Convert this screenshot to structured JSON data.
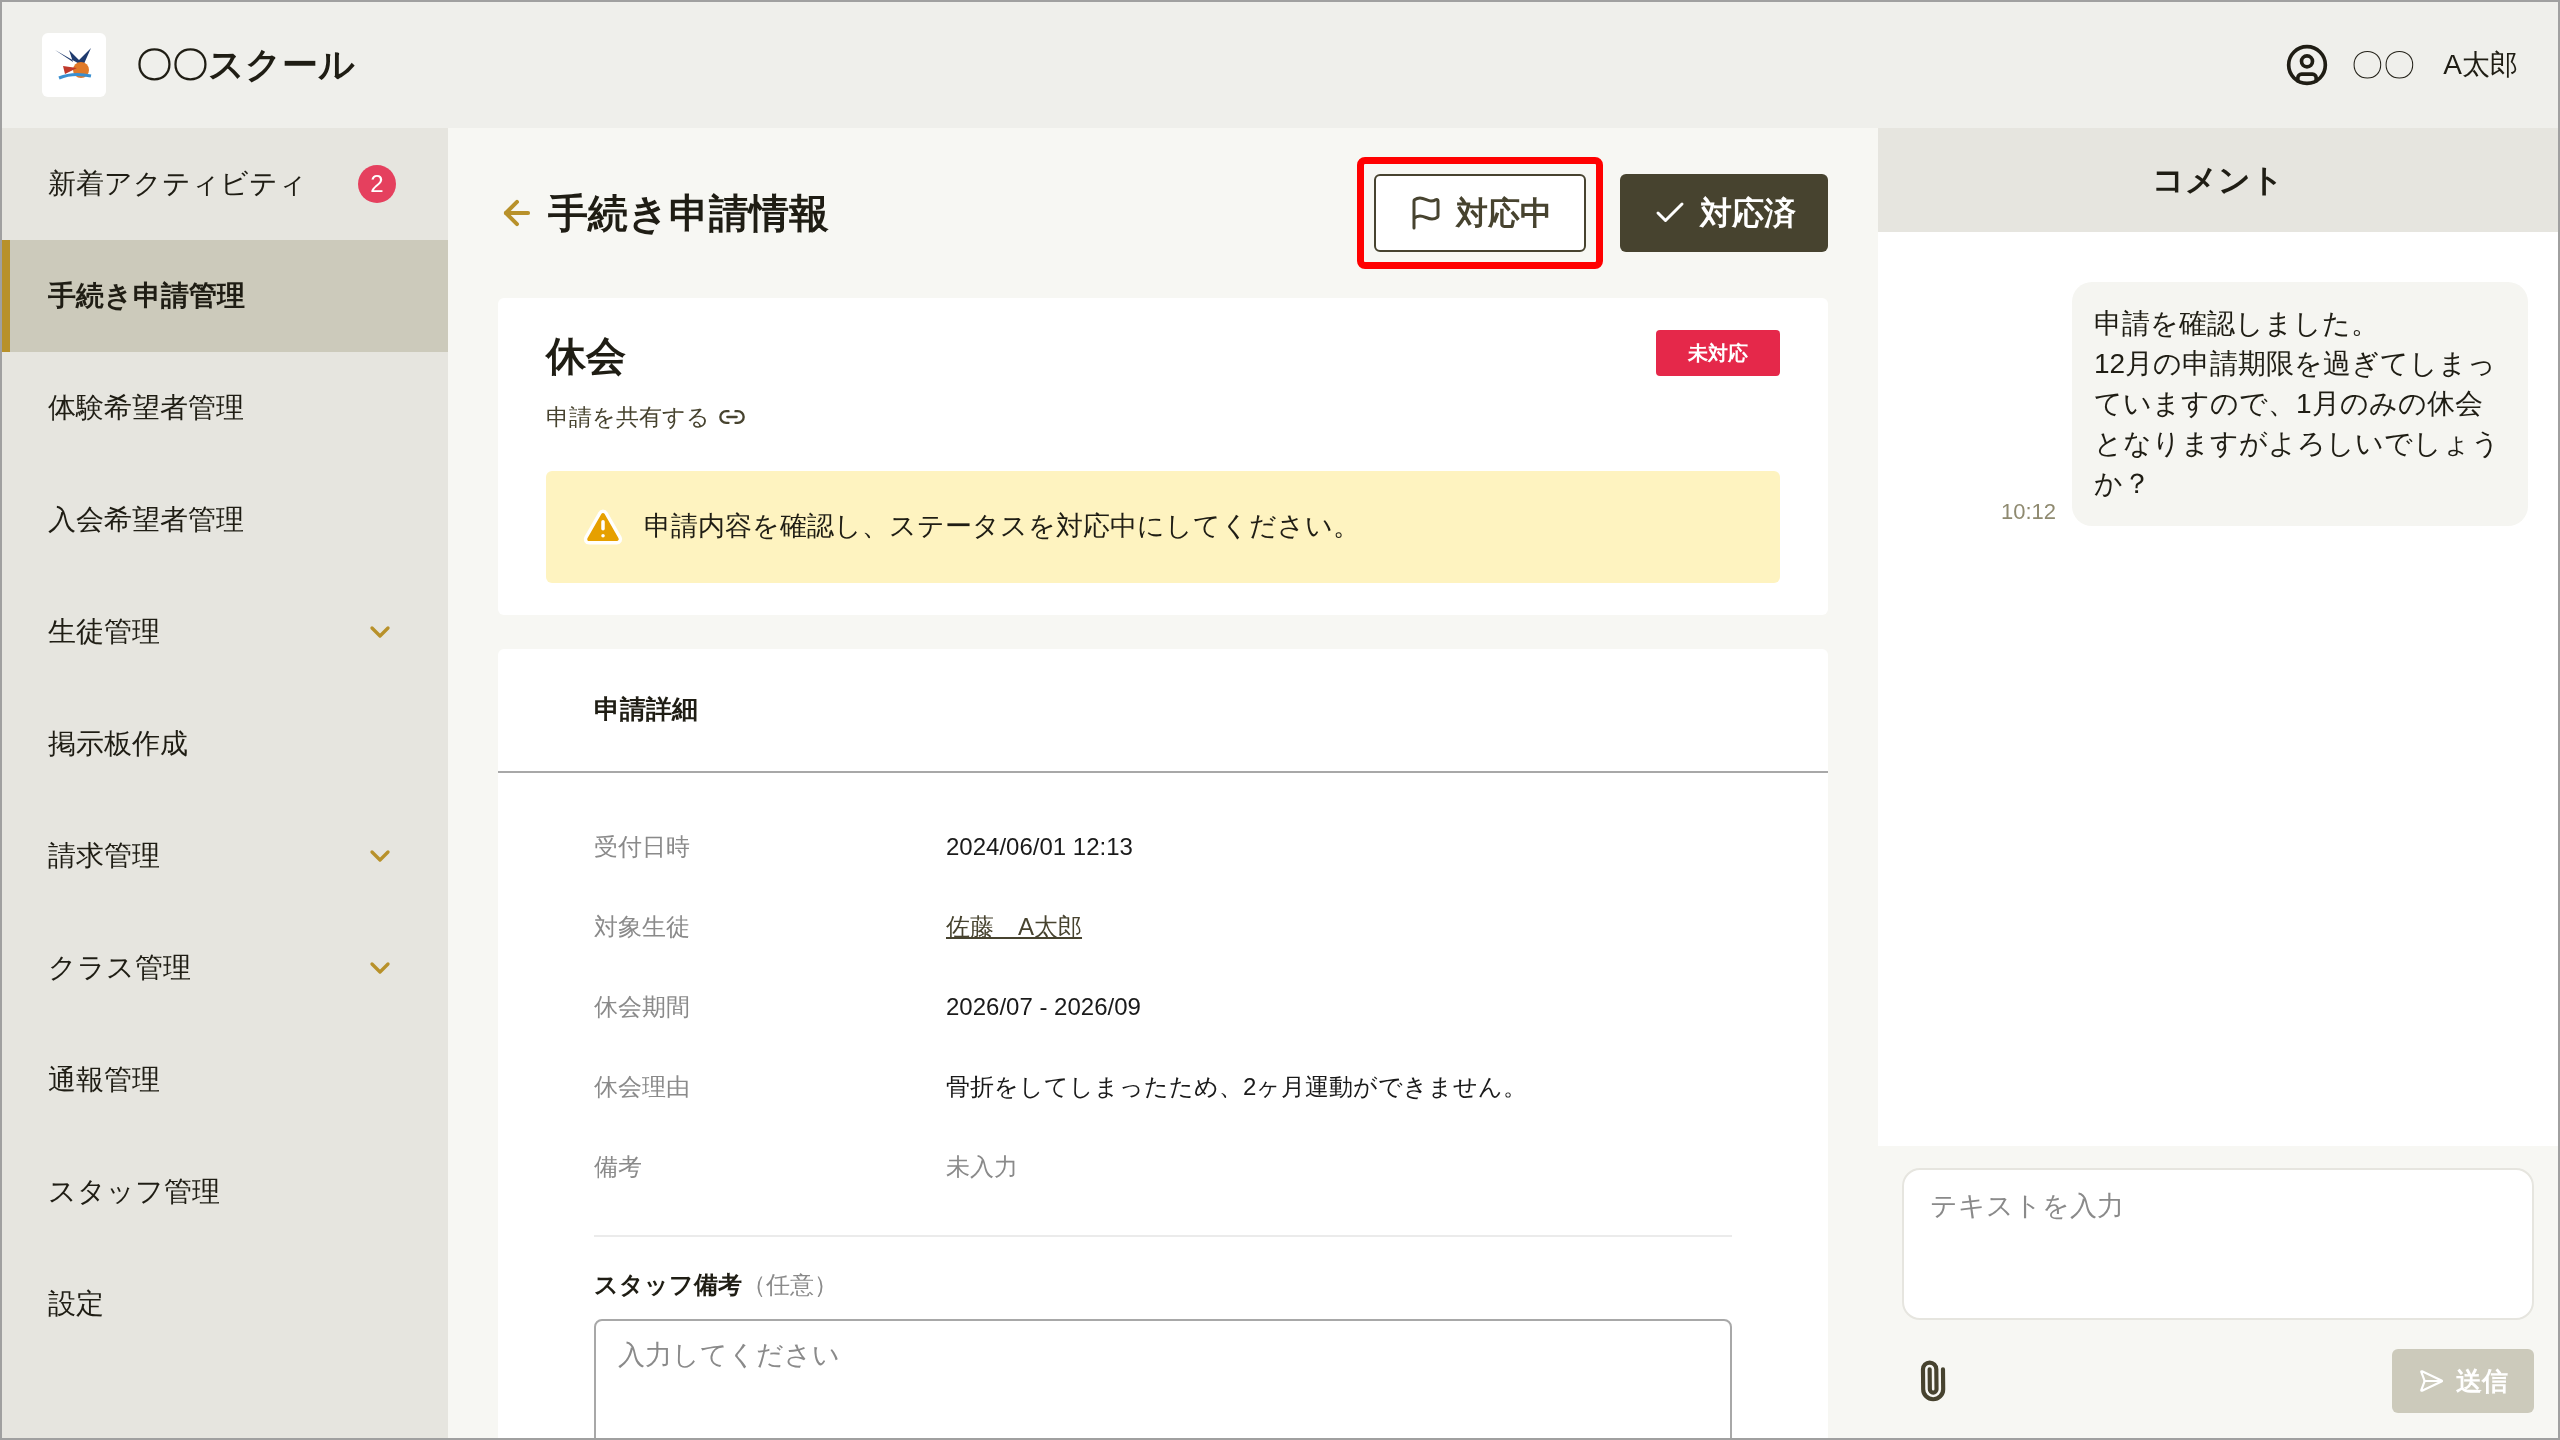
{
  "header": {
    "school_name": "〇〇スクール",
    "user_prefix": "〇〇",
    "user_name": "A太郎"
  },
  "sidebar": {
    "items": [
      {
        "label": "新着アクティビティ",
        "selected": false,
        "expandable": false,
        "badge": "2"
      },
      {
        "label": "手続き申請管理",
        "selected": true,
        "expandable": false
      },
      {
        "label": "体験希望者管理",
        "selected": false,
        "expandable": false
      },
      {
        "label": "入会希望者管理",
        "selected": false,
        "expandable": false
      },
      {
        "label": "生徒管理",
        "selected": false,
        "expandable": true
      },
      {
        "label": "掲示板作成",
        "selected": false,
        "expandable": false
      },
      {
        "label": "請求管理",
        "selected": false,
        "expandable": true
      },
      {
        "label": "クラス管理",
        "selected": false,
        "expandable": true
      },
      {
        "label": "通報管理",
        "selected": false,
        "expandable": false
      },
      {
        "label": "スタッフ管理",
        "selected": false,
        "expandable": false
      },
      {
        "label": "設定",
        "selected": false,
        "expandable": false
      }
    ]
  },
  "page": {
    "title": "手続き申請情報",
    "actions": [
      {
        "label": "対応中",
        "kind": "flag",
        "highlighted": true
      },
      {
        "label": "対応済",
        "kind": "check",
        "highlighted": false
      }
    ]
  },
  "request": {
    "type": "休会",
    "status": "未対応",
    "share_link": "申請を共有する",
    "alert": "申請内容を確認し、ステータスを対応中にしてください。"
  },
  "details": {
    "title": "申請詳細",
    "rows": [
      {
        "label": "受付日時",
        "value": "2024/06/01 12:13",
        "kind": "text"
      },
      {
        "label": "対象生徒",
        "value": "佐藤　A太郎",
        "kind": "link"
      },
      {
        "label": "休会期間",
        "value": "2026/07 - 2026/09",
        "kind": "text"
      },
      {
        "label": "休会理由",
        "value": "骨折をしてしまったため、2ヶ月運動ができません。",
        "kind": "text"
      },
      {
        "label": "備考",
        "value": "未入力",
        "kind": "empty"
      }
    ]
  },
  "staff_note": {
    "label": "スタッフ備考",
    "hint": "（任意）",
    "placeholder": "入力してください"
  },
  "comments": {
    "title": "コメント",
    "messages": [
      {
        "time": "10:12",
        "text": "申請を確認しました。\n12月の申請期限を過ぎてしまっていますので、1月のみの休会となりますがよろしいでしょうか？"
      }
    ],
    "input": {
      "placeholder": "テキストを入力"
    },
    "send_button": {
      "label": "送信",
      "disabled": true
    }
  }
}
